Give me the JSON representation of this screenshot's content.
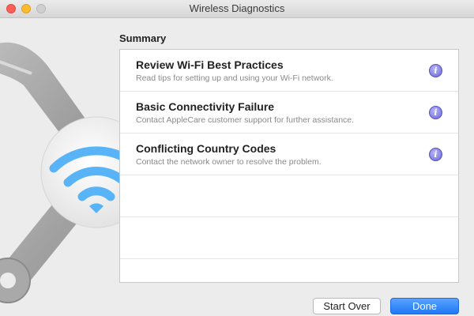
{
  "window": {
    "title": "Wireless Diagnostics",
    "controls": [
      "close",
      "minimize",
      "zoom"
    ]
  },
  "hero": {
    "icon": "wifi-tools-icon",
    "accent": "#3ea6f5"
  },
  "summary": {
    "heading": "Summary",
    "items": [
      {
        "title": "Review Wi-Fi Best Practices",
        "description": "Read tips for setting up and using your Wi-Fi network.",
        "icon": "info-icon"
      },
      {
        "title": "Basic Connectivity Failure",
        "description": "Contact AppleCare customer support for further assistance.",
        "icon": "info-icon"
      },
      {
        "title": "Conflicting Country Codes",
        "description": "Contact the network owner to resolve the problem.",
        "icon": "info-icon"
      }
    ],
    "info_glyph": "i"
  },
  "buttons": {
    "start_over": "Start Over",
    "done": "Done"
  },
  "colors": {
    "info_badge": "#7a77e6",
    "done_button": "#2a7ff6",
    "close_light": "#fc5f57",
    "minimize_light": "#fdbc2e"
  }
}
